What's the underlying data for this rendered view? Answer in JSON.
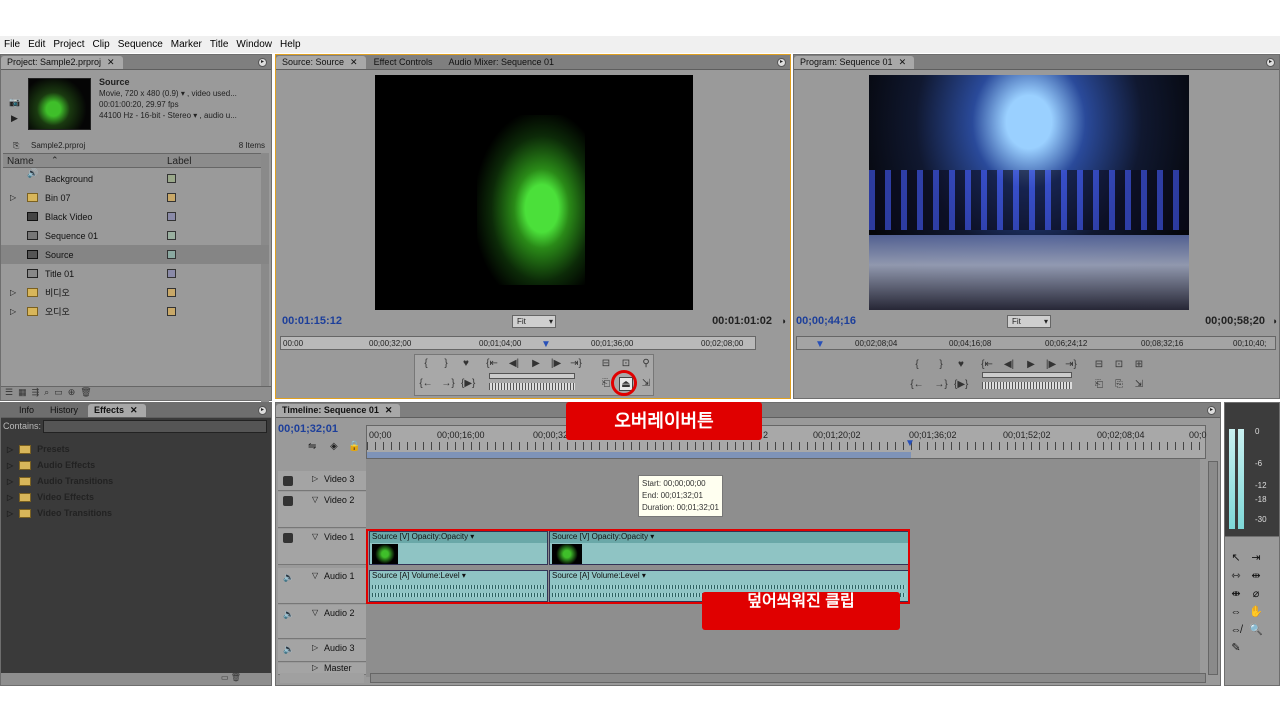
{
  "menu": [
    "File",
    "Edit",
    "Project",
    "Clip",
    "Sequence",
    "Marker",
    "Title",
    "Window",
    "Help"
  ],
  "project": {
    "tab": "Project: Sample2.prproj",
    "clip_name": "Source",
    "clip_info1": "Movie, 720 x 480 (0.9) ▾ , video used...",
    "clip_info2": "00:01:00:20, 29.97 fps",
    "clip_info3": "44100 Hz - 16-bit - Stereo ▾ , audio u...",
    "file": "Sample2.prproj",
    "count": "8 Items",
    "col_name": "Name",
    "col_label": "Label",
    "items": [
      {
        "name": "Background",
        "icon": "audio-clip-icon",
        "color": "#9aa88a"
      },
      {
        "name": "Bin 07",
        "icon": "folder-icon",
        "color": "#c8a868"
      },
      {
        "name": "Black Video",
        "icon": "video-clip-icon",
        "color": "#8a8aa8"
      },
      {
        "name": "Sequence 01",
        "icon": "sequence-icon",
        "color": "#9ab0a0"
      },
      {
        "name": "Source",
        "icon": "movie-clip-icon",
        "color": "#8aa8a0"
      },
      {
        "name": "Title 01",
        "icon": "title-icon",
        "color": "#8a8aa8"
      },
      {
        "name": "비디오",
        "icon": "folder-icon",
        "color": "#c8a868"
      },
      {
        "name": "오디오",
        "icon": "folder-icon",
        "color": "#c8a868"
      }
    ]
  },
  "effects_panel": {
    "tabs": [
      "Info",
      "History",
      "Effects"
    ],
    "contains_label": "Contains:",
    "items": [
      "Presets",
      "Audio Effects",
      "Audio Transitions",
      "Video Effects",
      "Video Transitions"
    ]
  },
  "source_monitor": {
    "tabs": [
      "Source: Source",
      "Effect Controls",
      "Audio Mixer: Sequence 01"
    ],
    "timecode_in": "00:01:15:12",
    "fit": "Fit",
    "duration": "00:01:01:02",
    "ruler": [
      "00:00",
      "00;00;32;00",
      "00;01;04;00",
      "00;01;36;00",
      "00;02;08;00"
    ]
  },
  "program_monitor": {
    "tab": "Program: Sequence 01",
    "timecode_in": "00;00;44;16",
    "fit": "Fit",
    "duration": "00;00;58;20",
    "ruler": [
      "00;02;08;04",
      "00;04;16;08",
      "00;06;24;12",
      "00;08;32;16",
      "00;10;40;"
    ]
  },
  "timeline": {
    "tab": "Timeline: Sequence 01",
    "timecode": "00;01;32;01",
    "ruler": [
      "00;00",
      "00;00;16;00",
      "00;00;32",
      "2",
      "00;01;20;02",
      "00;01;36;02",
      "00;01;52;02",
      "00;02;08;04",
      "00;0"
    ],
    "tracks": [
      "Video 3",
      "Video 2",
      "Video 1",
      "Audio 1",
      "Audio 2",
      "Audio 3",
      "Master"
    ],
    "tooltip": [
      "Start: 00;00;00;00",
      "End: 00;01;32;01",
      "Duration: 00;01;32;01"
    ],
    "clips": {
      "v1a_src": "Source",
      "v1a_tag": "[V]",
      "v1a_fx": "Opacity:Opacity ▾",
      "v1b_src": "Source",
      "v1b_tag": "[V]",
      "v1b_fx": "Opacity:Opacity ▾",
      "a1a_src": "Source",
      "a1a_tag": "[A]",
      "a1a_fx": "Volume:Level ▾",
      "a1b_src": "Source",
      "a1b_tag": "[A]",
      "a1b_fx": "Volume:Level ▾"
    }
  },
  "annotations": {
    "overwrite_button": "오버레이버튼",
    "overwritten_clip": "덮어씌워진 클립"
  },
  "meter": {
    "labels": [
      "0",
      "-6",
      "-12",
      "-18",
      "-30"
    ]
  },
  "colors": {
    "panel": "#9a9a9a",
    "tab": "#7f7f7f",
    "accent_red": "#e00000",
    "clip": "#8fc4c4",
    "timecode_blue": "#1d3f9a"
  }
}
